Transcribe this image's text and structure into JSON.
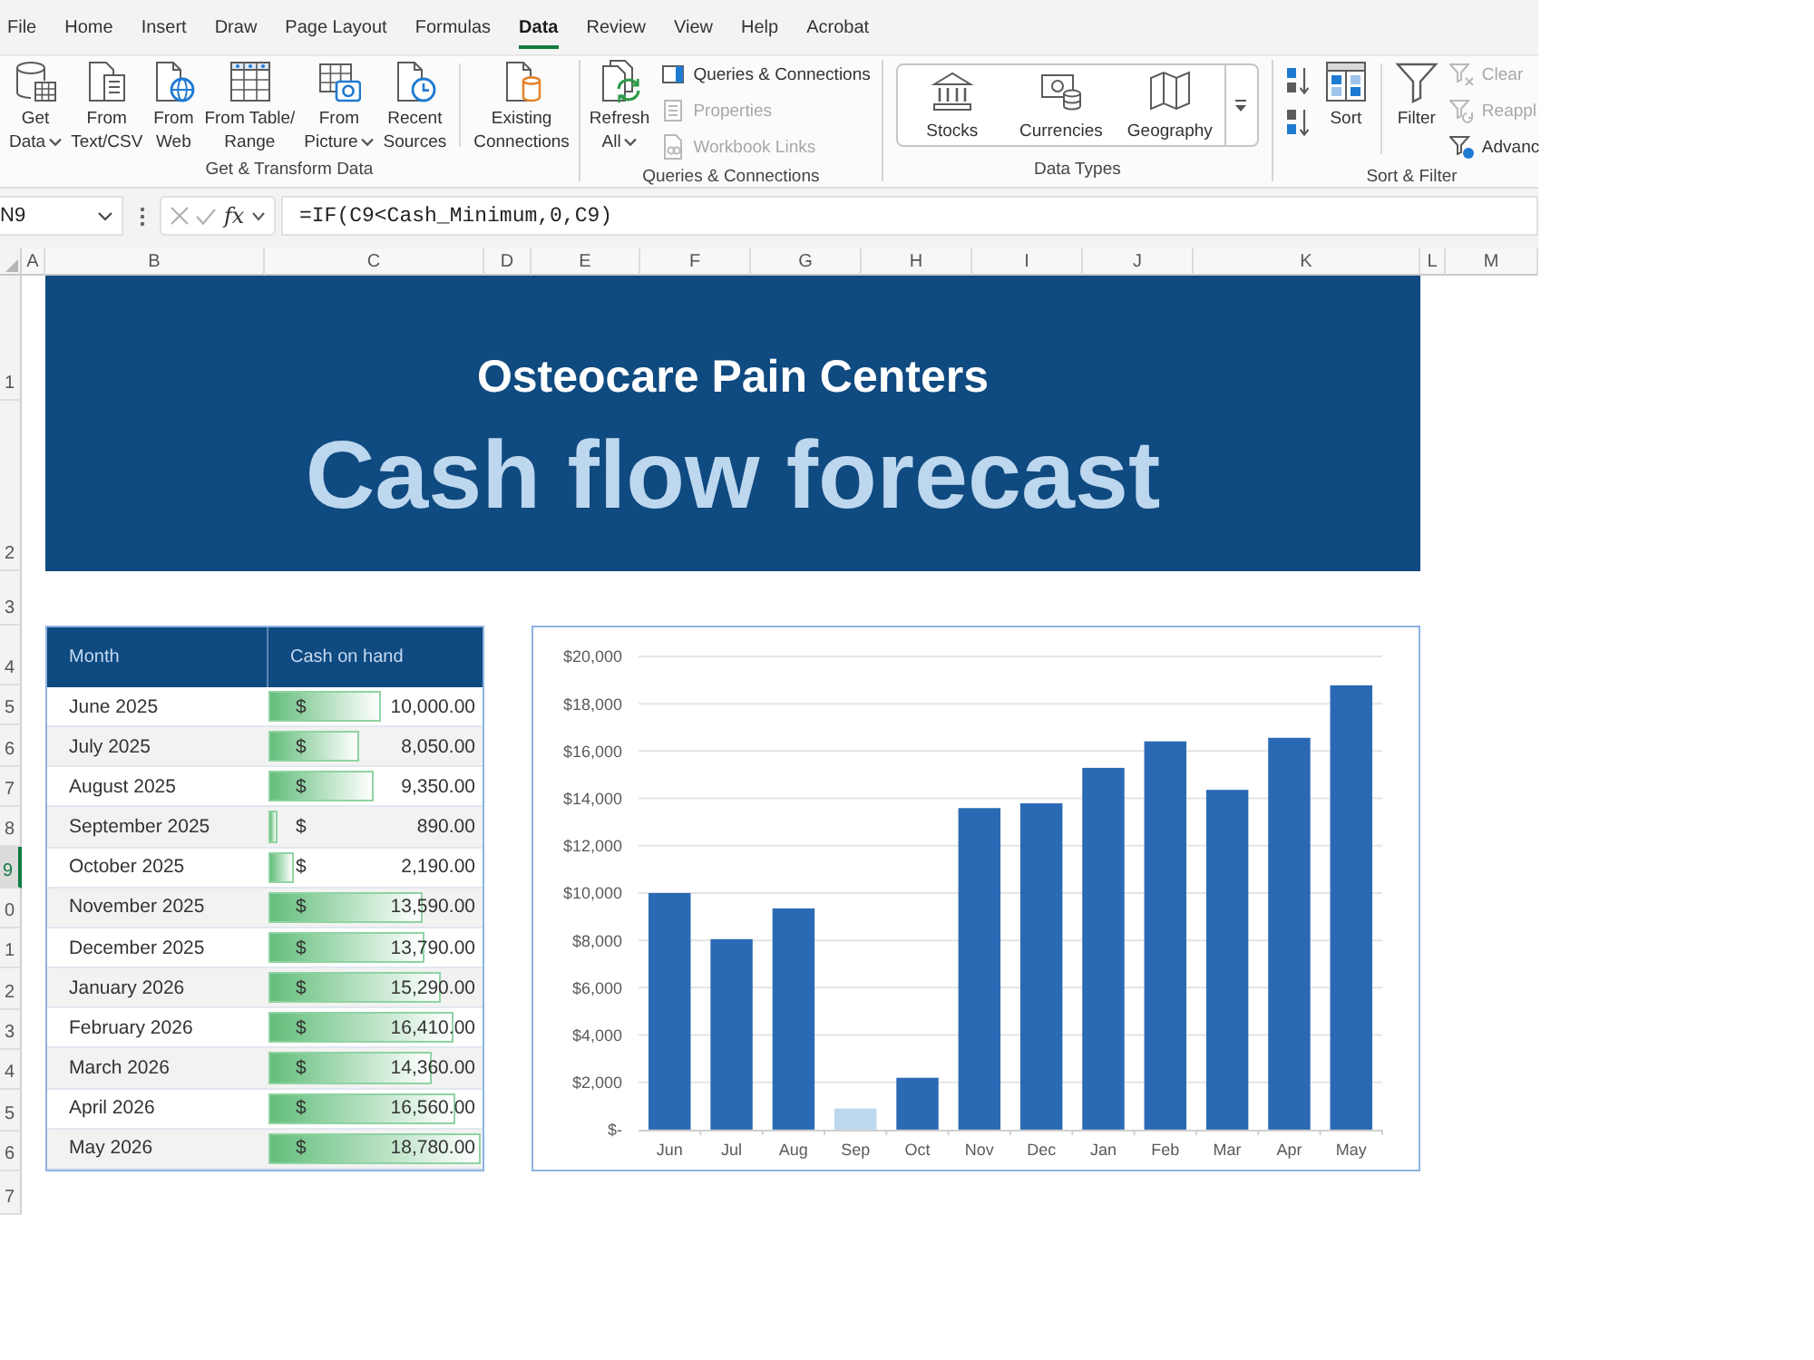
{
  "ribbon_tabs": [
    {
      "label": "File",
      "selected": false
    },
    {
      "label": "Home",
      "selected": false
    },
    {
      "label": "Insert",
      "selected": false
    },
    {
      "label": "Draw",
      "selected": false
    },
    {
      "label": "Page Layout",
      "selected": false
    },
    {
      "label": "Formulas",
      "selected": false
    },
    {
      "label": "Data",
      "selected": true
    },
    {
      "label": "Review",
      "selected": false
    },
    {
      "label": "View",
      "selected": false
    },
    {
      "label": "Help",
      "selected": false
    },
    {
      "label": "Acrobat",
      "selected": false
    }
  ],
  "ribbon_groups": [
    {
      "label": "Get & Transform Data",
      "controls": [
        {
          "kind": "large",
          "lines": [
            "Get",
            "Data"
          ],
          "dropdown": true
        },
        {
          "kind": "large",
          "lines": [
            "From",
            "Text/CSV"
          ],
          "dropdown": false
        },
        {
          "kind": "large",
          "lines": [
            "From",
            "Web"
          ],
          "dropdown": false
        },
        {
          "kind": "large",
          "lines": [
            "From Table/",
            "Range"
          ],
          "dropdown": false
        },
        {
          "kind": "large",
          "lines": [
            "From",
            "Picture"
          ],
          "dropdown": true
        },
        {
          "kind": "large",
          "lines": [
            "Recent",
            "Sources"
          ],
          "dropdown": false
        },
        {
          "kind": "divider"
        },
        {
          "kind": "large",
          "lines": [
            "Existing",
            "Connections"
          ],
          "dropdown": false
        }
      ]
    },
    {
      "label": "Queries & Connections",
      "controls": [
        {
          "kind": "large",
          "lines": [
            "Refresh",
            "All"
          ],
          "dropdown": true
        },
        {
          "kind": "stack",
          "items": [
            {
              "label": "Queries & Connections",
              "disabled": false
            },
            {
              "label": "Properties",
              "disabled": true
            },
            {
              "label": "Workbook Links",
              "disabled": true
            }
          ]
        }
      ]
    },
    {
      "label": "Data Types",
      "controls": [
        {
          "kind": "gallery",
          "items": [
            "Stocks",
            "Currencies",
            "Geography"
          ]
        }
      ]
    },
    {
      "label": "Sort & Filter",
      "controls": [
        {
          "kind": "sort_pair"
        },
        {
          "kind": "large",
          "lines": [
            "Sort"
          ],
          "dropdown": false
        },
        {
          "kind": "divider"
        },
        {
          "kind": "large",
          "lines": [
            "Filter"
          ],
          "dropdown": false
        },
        {
          "kind": "stack",
          "items": [
            {
              "label": "Clear",
              "disabled": true
            },
            {
              "label": "Reappl",
              "disabled": true
            },
            {
              "label": "Advanc",
              "disabled": false
            }
          ]
        }
      ]
    }
  ],
  "formula_bar": {
    "name_box": "N9",
    "function_label": "fx",
    "formula": "=IF(C9<Cash_Minimum,0,C9)"
  },
  "column_headers": [
    "A",
    "B",
    "C",
    "D",
    "E",
    "F",
    "G",
    "H",
    "I",
    "J",
    "K",
    "L",
    "M"
  ],
  "row_headers": [
    {
      "label": "1",
      "selected": false
    },
    {
      "label": "2",
      "selected": false
    },
    {
      "label": "3",
      "selected": false
    },
    {
      "label": "4",
      "selected": false
    },
    {
      "label": "5",
      "selected": false
    },
    {
      "label": "6",
      "selected": false
    },
    {
      "label": "7",
      "selected": false
    },
    {
      "label": "8",
      "selected": false
    },
    {
      "label": "9",
      "selected": true
    },
    {
      "label": "0",
      "selected": false
    },
    {
      "label": "1",
      "selected": false
    },
    {
      "label": "2",
      "selected": false
    },
    {
      "label": "3",
      "selected": false
    },
    {
      "label": "4",
      "selected": false
    },
    {
      "label": "5",
      "selected": false
    },
    {
      "label": "6",
      "selected": false
    },
    {
      "label": "7",
      "selected": false
    }
  ],
  "banner": {
    "subtitle": "Osteocare Pain Centers",
    "title": "Cash flow forecast"
  },
  "cash_table": {
    "columns": [
      "Month",
      "Cash on hand"
    ],
    "rows": [
      {
        "month": "June 2025",
        "currency": "$",
        "amount": "10,000.00",
        "level": 0.532
      },
      {
        "month": "July 2025",
        "currency": "$",
        "amount": "8,050.00",
        "level": 0.429
      },
      {
        "month": "August 2025",
        "currency": "$",
        "amount": "9,350.00",
        "level": 0.498
      },
      {
        "month": "September 2025",
        "currency": "$",
        "amount": "890.00",
        "level": 0.047
      },
      {
        "month": "October 2025",
        "currency": "$",
        "amount": "2,190.00",
        "level": 0.117
      },
      {
        "month": "November 2025",
        "currency": "$",
        "amount": "13,590.00",
        "level": 0.724
      },
      {
        "month": "December 2025",
        "currency": "$",
        "amount": "13,790.00",
        "level": 0.734
      },
      {
        "month": "January 2026",
        "currency": "$",
        "amount": "15,290.00",
        "level": 0.814
      },
      {
        "month": "February 2026",
        "currency": "$",
        "amount": "16,410.00",
        "level": 0.874
      },
      {
        "month": "March 2026",
        "currency": "$",
        "amount": "14,360.00",
        "level": 0.765
      },
      {
        "month": "April 2026",
        "currency": "$",
        "amount": "16,560.00",
        "level": 0.882
      },
      {
        "month": "May 2026",
        "currency": "$",
        "amount": "18,780.00",
        "level": 1.0
      }
    ]
  },
  "chart": {
    "chart_data": {
      "type": "bar",
      "categories": [
        "Jun",
        "Jul",
        "Aug",
        "Sep",
        "Oct",
        "Nov",
        "Dec",
        "Jan",
        "Feb",
        "Mar",
        "Apr",
        "May"
      ],
      "series": [
        {
          "color": "#2a6ab4",
          "values": [
            10000,
            8050,
            9350,
            null,
            2190,
            13590,
            13790,
            15290,
            16410,
            14360,
            16560,
            18780
          ]
        },
        {
          "color": "#bdd7ee",
          "values": [
            null,
            null,
            null,
            890,
            null,
            null,
            null,
            null,
            null,
            null,
            null,
            null
          ]
        }
      ],
      "stacked": true,
      "grid": true,
      "ylim": [
        0,
        20000
      ],
      "yticks": [
        {
          "value": 0,
          "label": "$-"
        },
        {
          "value": 2000,
          "label": "$2,000"
        },
        {
          "value": 4000,
          "label": "$4,000"
        },
        {
          "value": 6000,
          "label": "$6,000"
        },
        {
          "value": 8000,
          "label": "$8,000"
        },
        {
          "value": 10000,
          "label": "$10,000"
        },
        {
          "value": 12000,
          "label": "$12,000"
        },
        {
          "value": 14000,
          "label": "$14,000"
        },
        {
          "value": 16000,
          "label": "$16,000"
        },
        {
          "value": 18000,
          "label": "$18,000"
        },
        {
          "value": 20000,
          "label": "$20,000"
        }
      ]
    }
  }
}
